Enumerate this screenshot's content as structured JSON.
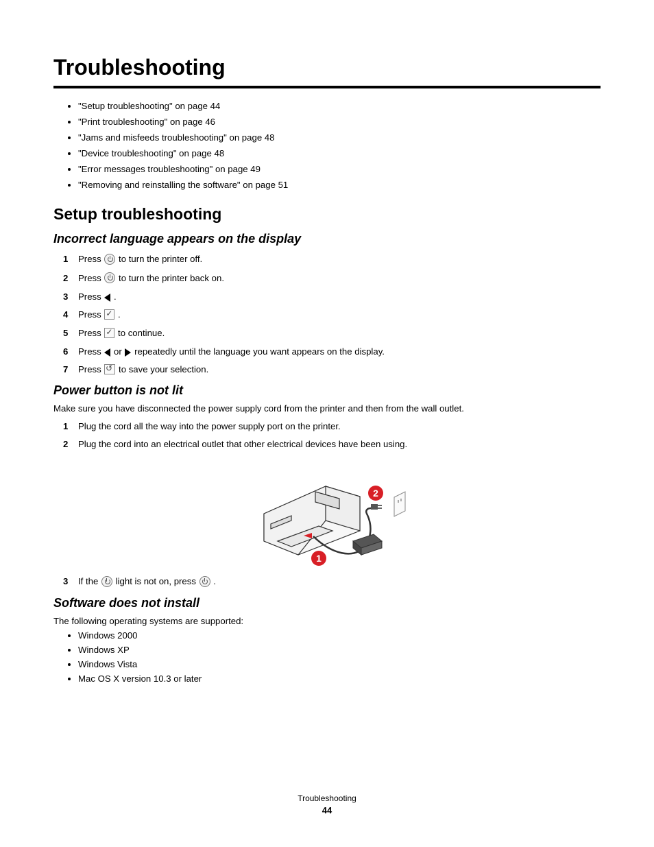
{
  "chapter_title": "Troubleshooting",
  "toc": [
    "\"Setup troubleshooting\" on page 44",
    "\"Print troubleshooting\" on page 46",
    "\"Jams and misfeeds troubleshooting\" on page 48",
    "\"Device troubleshooting\" on page 48",
    "\"Error messages troubleshooting\" on page 49",
    "\"Removing and reinstalling the software\" on page 51"
  ],
  "section1": {
    "title": "Setup troubleshooting",
    "sub1": {
      "title": "Incorrect language appears on the display",
      "steps": {
        "s1a": "Press ",
        "s1b": " to turn the printer off.",
        "s2a": "Press ",
        "s2b": " to turn the printer back on.",
        "s3a": "Press ",
        "s3b": ".",
        "s4a": "Press ",
        "s4b": ".",
        "s5a": "Press ",
        "s5b": " to continue.",
        "s6a": "Press ",
        "s6b": " or ",
        "s6c": " repeatedly until the language you want appears on the display.",
        "s7a": "Press ",
        "s7b": " to save your selection."
      }
    },
    "sub2": {
      "title": "Power button is not lit",
      "intro": "Make sure you have disconnected the power supply cord from the printer and then from the wall outlet.",
      "steps": {
        "s1": "Plug the cord all the way into the power supply port on the printer.",
        "s2": "Plug the cord into an electrical outlet that other electrical devices have been using.",
        "s3a": "If the ",
        "s3b": " light is not on, press ",
        "s3c": "."
      },
      "fig_labels": {
        "1": "1",
        "2": "2"
      }
    },
    "sub3": {
      "title": "Software does not install",
      "intro": "The following operating systems are supported:",
      "os": [
        "Windows 2000",
        "Windows XP",
        "Windows Vista",
        "Mac OS X version 10.3 or later"
      ]
    }
  },
  "footer": {
    "section": "Troubleshooting",
    "page": "44"
  }
}
